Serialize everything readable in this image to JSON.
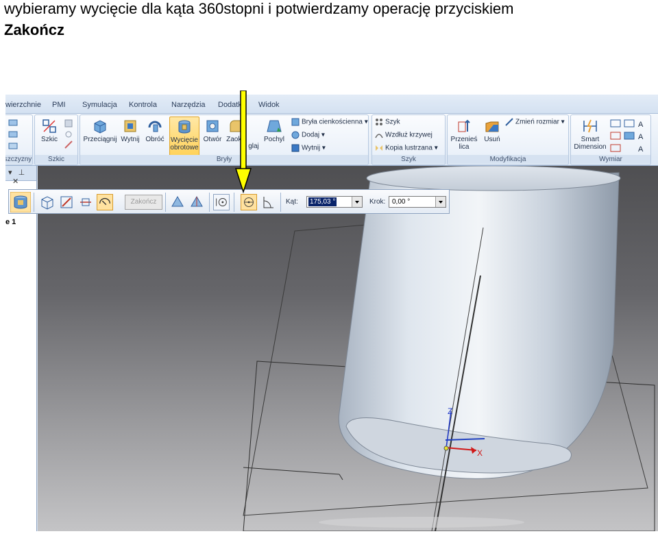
{
  "caption": {
    "line1": "wybieramy wycięcie dla kąta 360stopni i potwierdzamy operację przyciskiem",
    "line2": "Zakończ"
  },
  "tabs": [
    "wierzchnie",
    "PMI",
    "Symulacja",
    "Kontrola",
    "Narzędzia",
    "Dodatki",
    "Widok"
  ],
  "ribbon": {
    "sketch_group": {
      "label": "Szkic",
      "button": "Szkic",
      "left_label": "szczyzny"
    },
    "solids_group": {
      "label": "Bryły",
      "buttons": [
        "Przeciągnij",
        "Wytnij",
        "Obróć",
        "Wycięcie obrotowe",
        "Otwór",
        "Zaokr.",
        "glaj",
        "Pochyl"
      ],
      "small": [
        "Bryła cienkościenna",
        "Dodaj",
        "Wytnij"
      ]
    },
    "pattern_group": {
      "label": "Szyk",
      "small": [
        "Szyk",
        "Wzdłuż krzywej",
        "Kopia lustrzana"
      ]
    },
    "modify_group": {
      "label": "Modyfikacja",
      "buttons": [
        "Przenieś lica",
        "Usuń"
      ],
      "small": [
        "Zmień rozmiar"
      ]
    },
    "dimension_group": {
      "label": "Wymiar",
      "button": "Smart Dimension"
    }
  },
  "left_pane": {
    "item": "e 1"
  },
  "command_bar": {
    "finish_label": "Zakończ",
    "angle_label": "Kąt:",
    "angle_value": "175,03 °",
    "step_label": "Krok:",
    "step_value": "0,00 °"
  },
  "triad": {
    "x": "X",
    "z": "Z"
  },
  "colors": {
    "arrow": "#ffff00",
    "accent_active": "#ffd25a"
  },
  "icons": [
    "sketch-icon",
    "extrude-icon",
    "cut-icon",
    "revolve-icon",
    "revolved-cut-icon",
    "hole-icon",
    "round-icon",
    "draft-icon",
    "pattern-icon",
    "move-face-icon",
    "delete-icon",
    "smart-dimension-icon",
    "revolve-360-icon",
    "symmetric-icon"
  ]
}
